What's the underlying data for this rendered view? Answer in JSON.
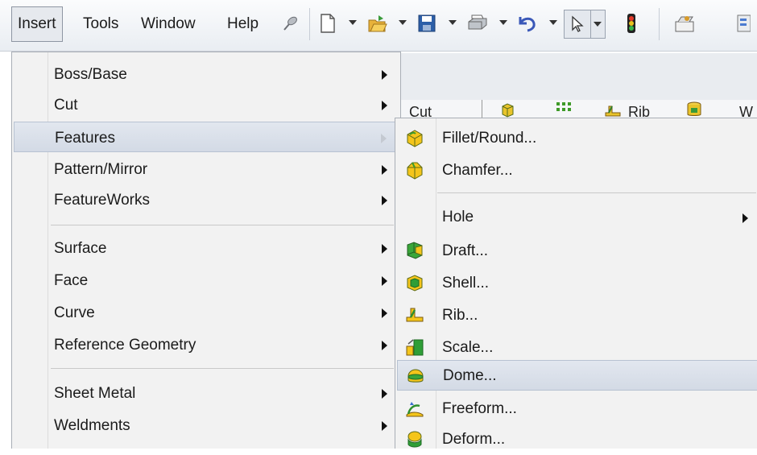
{
  "menubar": {
    "items": [
      {
        "label": "Insert",
        "active": true
      },
      {
        "label": "Tools"
      },
      {
        "label": "Window"
      },
      {
        "label": "Help"
      }
    ],
    "pin_icon": "pin-icon",
    "toolbar_icons": [
      "new-document-icon",
      "open-folder-icon",
      "save-icon",
      "print-icon",
      "undo-icon",
      "select-pointer-icon",
      "rebuild-traffic-light-icon",
      "options-icon"
    ]
  },
  "background_toolbar": {
    "items": [
      {
        "label": "Cut"
      },
      {
        "label": "Rib"
      },
      {
        "label": "W"
      }
    ]
  },
  "insert_menu": {
    "items": [
      {
        "label": "Boss/Base",
        "submenu": true
      },
      {
        "label": "Cut",
        "submenu": true
      },
      {
        "label": "Features",
        "submenu": true,
        "highlighted": true
      },
      {
        "label": "Pattern/Mirror",
        "submenu": true
      },
      {
        "label": "FeatureWorks",
        "submenu": true
      },
      {
        "label": "Surface",
        "submenu": true
      },
      {
        "label": "Face",
        "submenu": true
      },
      {
        "label": "Curve",
        "submenu": true
      },
      {
        "label": "Reference Geometry",
        "submenu": true
      },
      {
        "label": "Sheet Metal",
        "submenu": true
      },
      {
        "label": "Weldments",
        "submenu": true
      }
    ]
  },
  "features_menu": {
    "items": [
      {
        "label": "Fillet/Round...",
        "icon": "fillet-icon"
      },
      {
        "label": "Chamfer...",
        "icon": "chamfer-icon"
      },
      {
        "label": "Hole",
        "submenu": true
      },
      {
        "label": "Draft...",
        "icon": "draft-icon"
      },
      {
        "label": "Shell...",
        "icon": "shell-icon"
      },
      {
        "label": "Rib...",
        "icon": "rib-icon"
      },
      {
        "label": "Scale...",
        "icon": "scale-icon"
      },
      {
        "label": "Dome...",
        "icon": "dome-icon",
        "highlighted": true
      },
      {
        "label": "Freeform...",
        "icon": "freeform-icon"
      },
      {
        "label": "Deform...",
        "icon": "deform-icon"
      }
    ]
  },
  "colors": {
    "highlight": "#d8dee8",
    "menu_bg": "#f2f2f2",
    "icon_yellow": "#f5c400",
    "icon_green": "#2fa82f"
  }
}
